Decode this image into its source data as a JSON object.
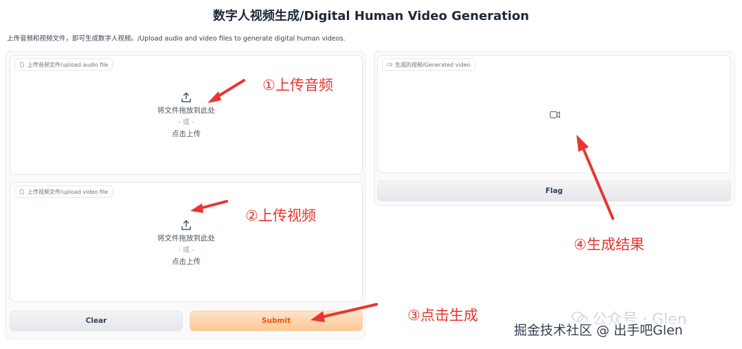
{
  "app": {
    "title": "数字人视频生成/Digital Human Video Generation",
    "description": "上传音频和视频文件，即可生成数字人视频。/Upload audio and video files to generate digital human videos."
  },
  "audio_upload": {
    "label": "上传音频文件/upload audio file",
    "drop_text": "将文件拖放到此处",
    "or_text": "- 或 -",
    "click_text": "点击上传",
    "icon": "upload-icon"
  },
  "video_upload": {
    "label": "上传视频文件/upload video file",
    "drop_text": "将文件拖放到此处",
    "or_text": "- 或 -",
    "click_text": "点击上传",
    "icon": "upload-icon"
  },
  "output": {
    "label": "生成的视频/Generated video",
    "icon": "video-camera-icon"
  },
  "buttons": {
    "clear": "Clear",
    "submit": "Submit",
    "flag": "Flag"
  },
  "annotations": {
    "step1": "①上传音频",
    "step2": "②上传视频",
    "step3": "③点击生成",
    "step4": "④生成结果",
    "color": "#e8352e"
  },
  "watermark": {
    "text": "公众号 · Glen",
    "credit": "掘金技术社区 @ 出手吧Glen"
  },
  "colors": {
    "submit_text": "#ea580c",
    "submit_bg": "#fbc892",
    "neutral_button": "#e5e7eb"
  }
}
